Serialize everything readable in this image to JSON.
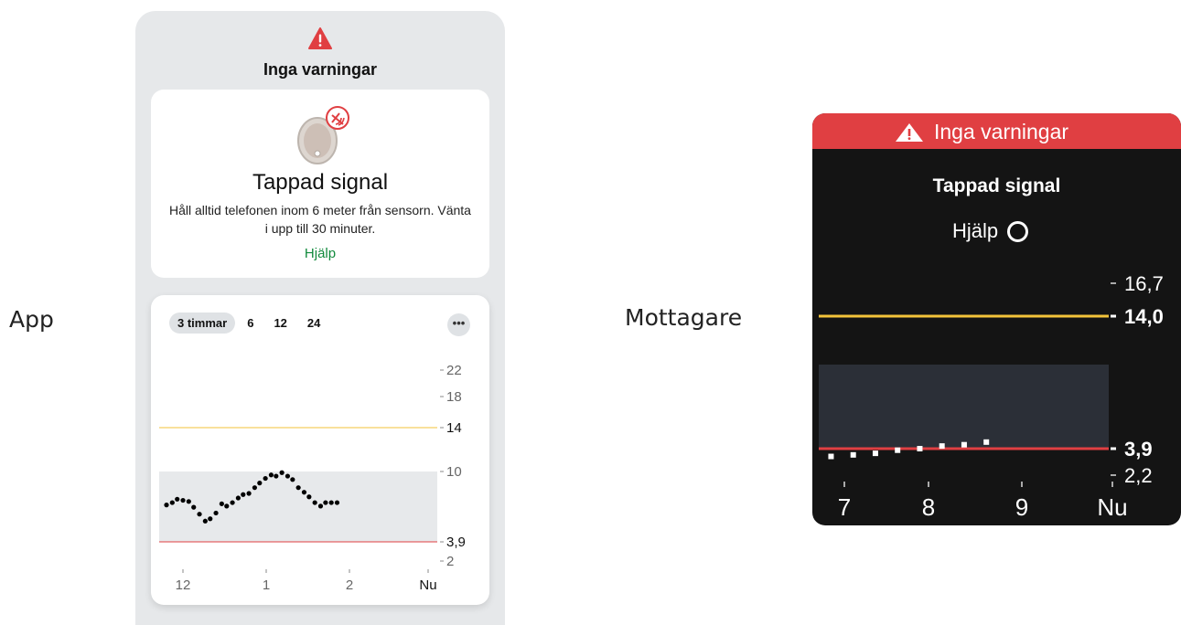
{
  "labels": {
    "app": "App",
    "receiver": "Mottagare"
  },
  "app": {
    "alert": {
      "title": "Inga varningar",
      "icon": "warning-triangle-icon",
      "color": "#e03f42"
    },
    "signal_card": {
      "icon": "sensor-signal-lost-icon",
      "title": "Tappad signal",
      "body": "Håll alltid telefonen inom 6 meter från sensorn. Vänta i upp till 30 minuter.",
      "help": "Hjälp"
    },
    "graph": {
      "range_tabs": [
        "3 timmar",
        "6",
        "12",
        "24"
      ],
      "selected_range": "3 timmar",
      "more_label": "•••"
    }
  },
  "receiver": {
    "banner": {
      "icon": "warning-triangle-icon",
      "text": "Inga varningar",
      "color": "#e03f42"
    },
    "title": "Tappad signal",
    "help": "Hjälp"
  },
  "chart_data": [
    {
      "type": "scatter",
      "name": "app-glucose-graph",
      "x_ticks": [
        "12",
        "1",
        "2",
        "Nu"
      ],
      "y_ticks": [
        "22",
        "18",
        "14",
        "10",
        "3,9",
        "2"
      ],
      "high_threshold": 14,
      "low_threshold": 3.9,
      "target_range": [
        3.9,
        10
      ],
      "colors": {
        "high": "#f3c33a",
        "low": "#e03f42",
        "target": "#e7e9eb",
        "points": "#000000"
      },
      "points": [
        [
          0.0,
          7.1
        ],
        [
          0.07,
          7.3
        ],
        [
          0.13,
          7.6
        ],
        [
          0.2,
          7.5
        ],
        [
          0.27,
          7.4
        ],
        [
          0.33,
          6.9
        ],
        [
          0.4,
          6.3
        ],
        [
          0.47,
          5.7
        ],
        [
          0.53,
          5.9
        ],
        [
          0.6,
          6.4
        ],
        [
          0.67,
          7.2
        ],
        [
          0.73,
          7.0
        ],
        [
          0.8,
          7.3
        ],
        [
          0.87,
          7.7
        ],
        [
          0.93,
          8.0
        ],
        [
          1.0,
          8.1
        ],
        [
          1.07,
          8.6
        ],
        [
          1.13,
          9.0
        ],
        [
          1.2,
          9.4
        ],
        [
          1.27,
          9.7
        ],
        [
          1.33,
          9.6
        ],
        [
          1.4,
          9.9
        ],
        [
          1.47,
          9.6
        ],
        [
          1.53,
          9.3
        ],
        [
          1.6,
          8.6
        ],
        [
          1.67,
          8.2
        ],
        [
          1.73,
          7.8
        ],
        [
          1.8,
          7.3
        ],
        [
          1.87,
          7.0
        ],
        [
          1.93,
          7.3
        ],
        [
          2.0,
          7.3
        ],
        [
          2.07,
          7.3
        ]
      ]
    },
    {
      "type": "scatter",
      "name": "receiver-glucose-graph",
      "x_ticks": [
        "7",
        "8",
        "9",
        "Nu"
      ],
      "y_ticks": [
        "16,7",
        "14,0",
        "3,9",
        "2,2"
      ],
      "high_threshold": 14.0,
      "low_threshold": 3.9,
      "colors": {
        "high": "#f3c33a",
        "low": "#e03f42",
        "target": "#2b2f37",
        "points": "#ffffff"
      },
      "points": [
        [
          6.85,
          3.4
        ],
        [
          7.1,
          3.5
        ],
        [
          7.35,
          3.6
        ],
        [
          7.6,
          3.8
        ],
        [
          7.85,
          3.9
        ],
        [
          8.1,
          4.1
        ],
        [
          8.35,
          4.2
        ],
        [
          8.6,
          4.4
        ]
      ]
    }
  ]
}
